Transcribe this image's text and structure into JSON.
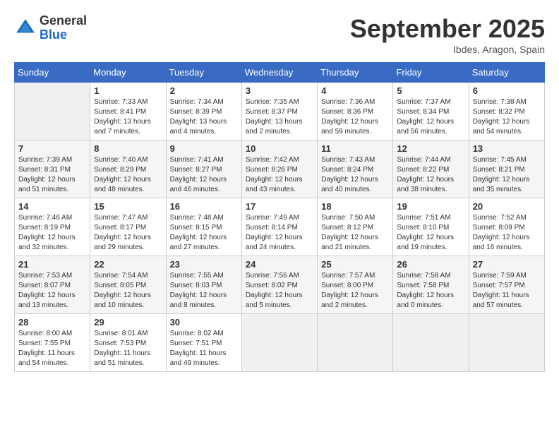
{
  "logo": {
    "general": "General",
    "blue": "Blue"
  },
  "title": "September 2025",
  "location": "Ibdes, Aragon, Spain",
  "weekdays": [
    "Sunday",
    "Monday",
    "Tuesday",
    "Wednesday",
    "Thursday",
    "Friday",
    "Saturday"
  ],
  "weeks": [
    [
      {
        "day": "",
        "sunrise": "",
        "sunset": "",
        "daylight": ""
      },
      {
        "day": "1",
        "sunrise": "Sunrise: 7:33 AM",
        "sunset": "Sunset: 8:41 PM",
        "daylight": "Daylight: 13 hours and 7 minutes."
      },
      {
        "day": "2",
        "sunrise": "Sunrise: 7:34 AM",
        "sunset": "Sunset: 8:39 PM",
        "daylight": "Daylight: 13 hours and 4 minutes."
      },
      {
        "day": "3",
        "sunrise": "Sunrise: 7:35 AM",
        "sunset": "Sunset: 8:37 PM",
        "daylight": "Daylight: 13 hours and 2 minutes."
      },
      {
        "day": "4",
        "sunrise": "Sunrise: 7:36 AM",
        "sunset": "Sunset: 8:36 PM",
        "daylight": "Daylight: 12 hours and 59 minutes."
      },
      {
        "day": "5",
        "sunrise": "Sunrise: 7:37 AM",
        "sunset": "Sunset: 8:34 PM",
        "daylight": "Daylight: 12 hours and 56 minutes."
      },
      {
        "day": "6",
        "sunrise": "Sunrise: 7:38 AM",
        "sunset": "Sunset: 8:32 PM",
        "daylight": "Daylight: 12 hours and 54 minutes."
      }
    ],
    [
      {
        "day": "7",
        "sunrise": "Sunrise: 7:39 AM",
        "sunset": "Sunset: 8:31 PM",
        "daylight": "Daylight: 12 hours and 51 minutes."
      },
      {
        "day": "8",
        "sunrise": "Sunrise: 7:40 AM",
        "sunset": "Sunset: 8:29 PM",
        "daylight": "Daylight: 12 hours and 48 minutes."
      },
      {
        "day": "9",
        "sunrise": "Sunrise: 7:41 AM",
        "sunset": "Sunset: 8:27 PM",
        "daylight": "Daylight: 12 hours and 46 minutes."
      },
      {
        "day": "10",
        "sunrise": "Sunrise: 7:42 AM",
        "sunset": "Sunset: 8:26 PM",
        "daylight": "Daylight: 12 hours and 43 minutes."
      },
      {
        "day": "11",
        "sunrise": "Sunrise: 7:43 AM",
        "sunset": "Sunset: 8:24 PM",
        "daylight": "Daylight: 12 hours and 40 minutes."
      },
      {
        "day": "12",
        "sunrise": "Sunrise: 7:44 AM",
        "sunset": "Sunset: 8:22 PM",
        "daylight": "Daylight: 12 hours and 38 minutes."
      },
      {
        "day": "13",
        "sunrise": "Sunrise: 7:45 AM",
        "sunset": "Sunset: 8:21 PM",
        "daylight": "Daylight: 12 hours and 35 minutes."
      }
    ],
    [
      {
        "day": "14",
        "sunrise": "Sunrise: 7:46 AM",
        "sunset": "Sunset: 8:19 PM",
        "daylight": "Daylight: 12 hours and 32 minutes."
      },
      {
        "day": "15",
        "sunrise": "Sunrise: 7:47 AM",
        "sunset": "Sunset: 8:17 PM",
        "daylight": "Daylight: 12 hours and 29 minutes."
      },
      {
        "day": "16",
        "sunrise": "Sunrise: 7:48 AM",
        "sunset": "Sunset: 8:15 PM",
        "daylight": "Daylight: 12 hours and 27 minutes."
      },
      {
        "day": "17",
        "sunrise": "Sunrise: 7:49 AM",
        "sunset": "Sunset: 8:14 PM",
        "daylight": "Daylight: 12 hours and 24 minutes."
      },
      {
        "day": "18",
        "sunrise": "Sunrise: 7:50 AM",
        "sunset": "Sunset: 8:12 PM",
        "daylight": "Daylight: 12 hours and 21 minutes."
      },
      {
        "day": "19",
        "sunrise": "Sunrise: 7:51 AM",
        "sunset": "Sunset: 8:10 PM",
        "daylight": "Daylight: 12 hours and 19 minutes."
      },
      {
        "day": "20",
        "sunrise": "Sunrise: 7:52 AM",
        "sunset": "Sunset: 8:09 PM",
        "daylight": "Daylight: 12 hours and 16 minutes."
      }
    ],
    [
      {
        "day": "21",
        "sunrise": "Sunrise: 7:53 AM",
        "sunset": "Sunset: 8:07 PM",
        "daylight": "Daylight: 12 hours and 13 minutes."
      },
      {
        "day": "22",
        "sunrise": "Sunrise: 7:54 AM",
        "sunset": "Sunset: 8:05 PM",
        "daylight": "Daylight: 12 hours and 10 minutes."
      },
      {
        "day": "23",
        "sunrise": "Sunrise: 7:55 AM",
        "sunset": "Sunset: 8:03 PM",
        "daylight": "Daylight: 12 hours and 8 minutes."
      },
      {
        "day": "24",
        "sunrise": "Sunrise: 7:56 AM",
        "sunset": "Sunset: 8:02 PM",
        "daylight": "Daylight: 12 hours and 5 minutes."
      },
      {
        "day": "25",
        "sunrise": "Sunrise: 7:57 AM",
        "sunset": "Sunset: 8:00 PM",
        "daylight": "Daylight: 12 hours and 2 minutes."
      },
      {
        "day": "26",
        "sunrise": "Sunrise: 7:58 AM",
        "sunset": "Sunset: 7:58 PM",
        "daylight": "Daylight: 12 hours and 0 minutes."
      },
      {
        "day": "27",
        "sunrise": "Sunrise: 7:59 AM",
        "sunset": "Sunset: 7:57 PM",
        "daylight": "Daylight: 11 hours and 57 minutes."
      }
    ],
    [
      {
        "day": "28",
        "sunrise": "Sunrise: 8:00 AM",
        "sunset": "Sunset: 7:55 PM",
        "daylight": "Daylight: 11 hours and 54 minutes."
      },
      {
        "day": "29",
        "sunrise": "Sunrise: 8:01 AM",
        "sunset": "Sunset: 7:53 PM",
        "daylight": "Daylight: 11 hours and 51 minutes."
      },
      {
        "day": "30",
        "sunrise": "Sunrise: 8:02 AM",
        "sunset": "Sunset: 7:51 PM",
        "daylight": "Daylight: 11 hours and 49 minutes."
      },
      {
        "day": "",
        "sunrise": "",
        "sunset": "",
        "daylight": ""
      },
      {
        "day": "",
        "sunrise": "",
        "sunset": "",
        "daylight": ""
      },
      {
        "day": "",
        "sunrise": "",
        "sunset": "",
        "daylight": ""
      },
      {
        "day": "",
        "sunrise": "",
        "sunset": "",
        "daylight": ""
      }
    ]
  ]
}
